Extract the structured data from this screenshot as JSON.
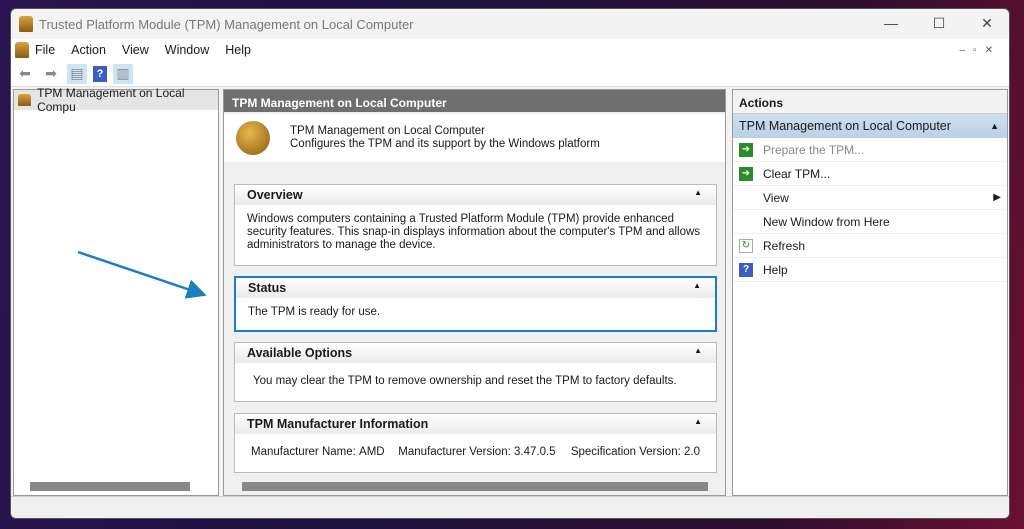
{
  "window": {
    "title": "Trusted Platform Module (TPM) Management on Local Computer",
    "minimize": "—",
    "maximize": "☐",
    "close": "✕"
  },
  "menu": [
    "File",
    "Action",
    "View",
    "Window",
    "Help"
  ],
  "tree": {
    "root": "TPM Management on Local Compu"
  },
  "center": {
    "header": "TPM Management on Local Computer",
    "intro_title": "TPM Management on Local Computer",
    "intro_desc": "Configures the TPM and its support by the Windows platform",
    "overview": {
      "title": "Overview",
      "text": "Windows computers containing a Trusted Platform Module (TPM) provide enhanced security features. This snap-in displays information about the computer's TPM and allows administrators to manage the device."
    },
    "status": {
      "title": "Status",
      "text": "The TPM is ready for use."
    },
    "options": {
      "title": "Available Options",
      "text": "You may clear the TPM to remove ownership and reset the TPM to factory defaults."
    },
    "manufacturer": {
      "title": "TPM Manufacturer Information",
      "name_label": "Manufacturer Name:",
      "name": "AMD",
      "version_label": "Manufacturer Version:",
      "version": "3.47.0.5",
      "spec_label": "Specification Version:",
      "spec": "2.0"
    }
  },
  "actions": {
    "header": "Actions",
    "group": "TPM Management on Local Computer",
    "items": [
      {
        "label": "Prepare the TPM...",
        "icon": "green-arrow-icon",
        "disabled": true
      },
      {
        "label": "Clear TPM...",
        "icon": "green-arrow-icon"
      },
      {
        "label": "View",
        "icon": "none",
        "submenu": true
      },
      {
        "label": "New Window from Here",
        "icon": "none"
      },
      {
        "label": "Refresh",
        "icon": "refresh-icon"
      },
      {
        "label": "Help",
        "icon": "help-icon"
      }
    ]
  },
  "colors": {
    "highlight": "#1a7fc0",
    "annotation_arrow": "#1a7fc0"
  }
}
